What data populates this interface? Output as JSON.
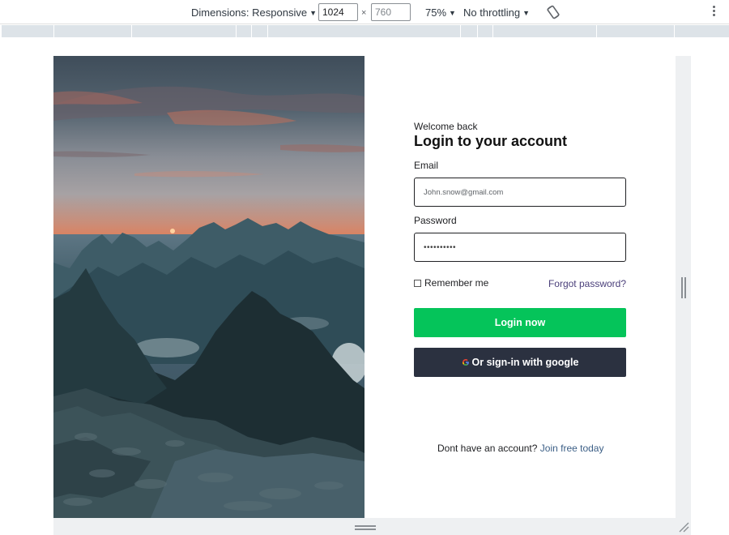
{
  "devtools": {
    "dimensions_label": "Dimensions: Responsive",
    "width_value": "1024",
    "height_value": "760",
    "times_sign": "×",
    "zoom": "75%",
    "throttling": "No throttling",
    "icons": [
      "caret-down-icon",
      "rotate-icon",
      "more-options-icon"
    ]
  },
  "login": {
    "welcome": "Welcome back",
    "title": "Login to your account",
    "email_label": "Email",
    "email_value": "John.snow@gmail.com",
    "password_label": "Password",
    "password_value": "••••••••••",
    "remember_label": "Remember me",
    "forgot_link": "Forgot password?",
    "login_button": "Login now",
    "google_button": "Or sign-in with google",
    "signup_prompt": "Dont have an account?",
    "signup_link": "Join free today"
  },
  "colors": {
    "login_button": "#05c45a",
    "google_button": "#2b3140",
    "link": "#3c5f86"
  }
}
